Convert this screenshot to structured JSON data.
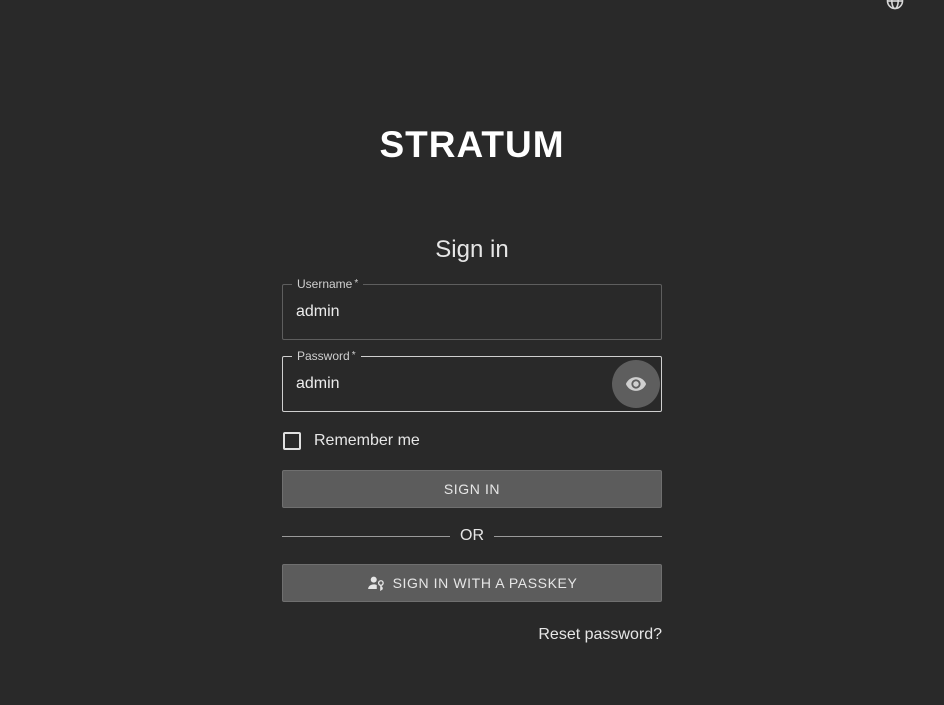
{
  "header": {
    "brand": "STRATUM",
    "language_icon": "globe-icon"
  },
  "form": {
    "title": "Sign in",
    "username": {
      "label": "Username",
      "required_mark": "*",
      "value": "admin"
    },
    "password": {
      "label": "Password",
      "required_mark": "*",
      "value": "admin",
      "toggle_icon": "eye-icon"
    },
    "remember_me": {
      "label": "Remember me",
      "checked": false
    },
    "sign_in_label": "SIGN IN",
    "divider_label": "OR",
    "passkey_label": "SIGN IN WITH A PASSKEY",
    "passkey_icon": "passkey-user-icon",
    "reset_password_label": "Reset password?"
  },
  "colors": {
    "background": "#292929",
    "button": "#5c5c5c",
    "eye_button": "#5e5e5e",
    "text": "#e6e6e6"
  }
}
